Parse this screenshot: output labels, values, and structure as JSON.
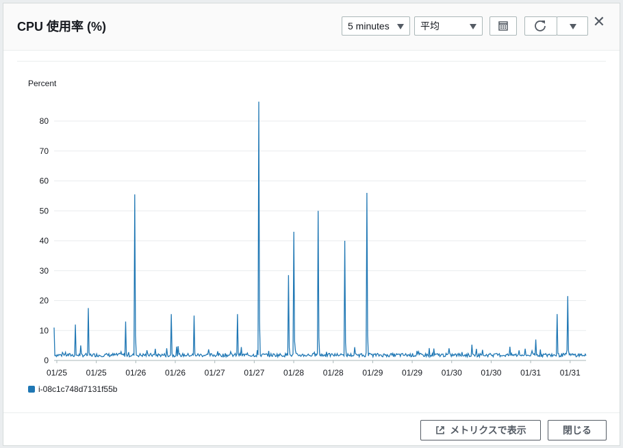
{
  "modal": {
    "title": "CPU 使用率 (%)",
    "period_select": "5 minutes",
    "stat_select": "平均",
    "footer": {
      "view_metrics_label": "メトリクスで表示",
      "close_label": "閉じる"
    }
  },
  "icons": {
    "calendar": "calendar-icon",
    "refresh": "refresh-icon",
    "dropdown": "chevron-down-icon",
    "close": "close-icon",
    "external_link": "external-link-icon"
  },
  "chart_data": {
    "type": "line",
    "ylabel": "Percent",
    "ylim": [
      0,
      88
    ],
    "yticks": [
      0,
      10,
      20,
      30,
      40,
      50,
      60,
      70,
      80
    ],
    "x_ticks": [
      "01/25",
      "01/25",
      "01/26",
      "01/26",
      "01/27",
      "01/27",
      "01/28",
      "01/28",
      "01/29",
      "01/29",
      "01/30",
      "01/30",
      "01/31",
      "01/31"
    ],
    "grid": true,
    "legend": "bottom-left",
    "series": [
      {
        "name": "i-08c1c748d7131f55b",
        "color": "#1f77b4",
        "peaks": [
          {
            "t": 0.0,
            "v": 11
          },
          {
            "t": 0.04,
            "v": 12
          },
          {
            "t": 0.065,
            "v": 17.5
          },
          {
            "t": 0.135,
            "v": 13
          },
          {
            "t": 0.152,
            "v": 55.5
          },
          {
            "t": 0.22,
            "v": 15.5
          },
          {
            "t": 0.263,
            "v": 15
          },
          {
            "t": 0.345,
            "v": 15.5
          },
          {
            "t": 0.385,
            "v": 86.5
          },
          {
            "t": 0.44,
            "v": 28.5
          },
          {
            "t": 0.45,
            "v": 43
          },
          {
            "t": 0.497,
            "v": 50
          },
          {
            "t": 0.546,
            "v": 40
          },
          {
            "t": 0.588,
            "v": 56
          },
          {
            "t": 0.905,
            "v": 7
          },
          {
            "t": 0.946,
            "v": 15.5
          },
          {
            "t": 0.965,
            "v": 21.5
          }
        ],
        "baseline": 1.2
      }
    ]
  }
}
